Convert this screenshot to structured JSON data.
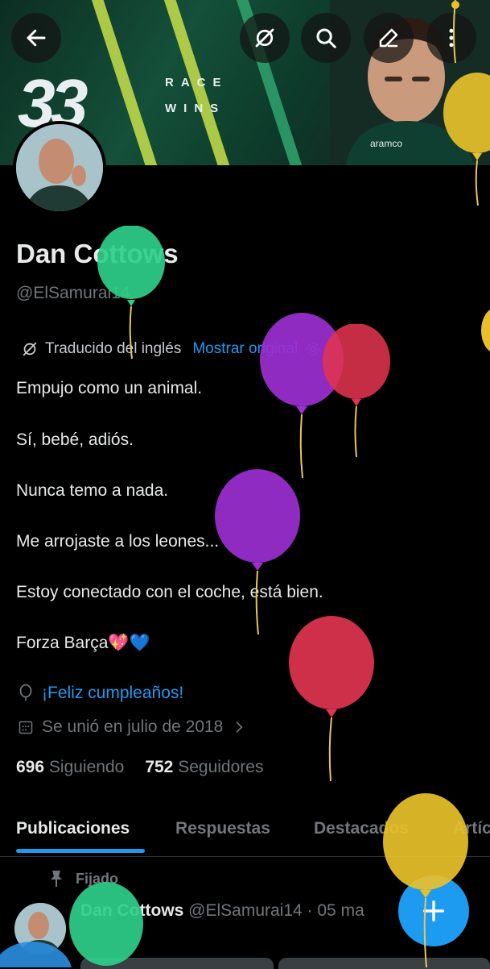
{
  "profile": {
    "name": "Dan Cottows",
    "handle": "@ElSamurai14"
  },
  "banner": {
    "number": "33",
    "line1": "RACE",
    "line2": "WINS",
    "sponsor": "aramco"
  },
  "translation": {
    "label": "Traducido del inglés",
    "show_original": "Mostrar original"
  },
  "bio": [
    "Empujo como un animal.",
    "Sí, bebé, adiós.",
    "Nunca temo a nada.",
    "Me arrojaste a los leones...",
    "Estoy conectado con el coche, está bien.",
    "Forza Barça💖💙"
  ],
  "birthday": "¡Feliz cumpleaños!",
  "joined": "Se unió en julio de 2018",
  "stats": {
    "following_count": "696",
    "following_label": "Siguiendo",
    "followers_count": "752",
    "followers_label": "Seguidores"
  },
  "tabs": [
    "Publicaciones",
    "Respuestas",
    "Destacados",
    "Artíc"
  ],
  "pinned_label": "Fijado",
  "post": {
    "author": "Dan Cottows",
    "handle_date": "@ElSamurai14 · 05 ma"
  },
  "icons": {
    "back": "back-arrow-icon",
    "translate": "translate-icon",
    "search": "search-icon",
    "edit": "edit-icon",
    "more": "more-vertical-icon",
    "settings": "gear-icon",
    "balloon": "birthday-icon",
    "calendar": "calendar-icon",
    "chevron": "chevron-right-icon",
    "pin": "pin-icon",
    "compose": "plus-icon"
  },
  "colors": {
    "accent": "#1d9bf0",
    "background": "#000000",
    "muted_text": "#71767b",
    "balloon_green": "#2ecf8a",
    "balloon_purple": "#9b2fd0",
    "balloon_red": "#e0334f",
    "balloon_gold": "#e8c12a"
  }
}
